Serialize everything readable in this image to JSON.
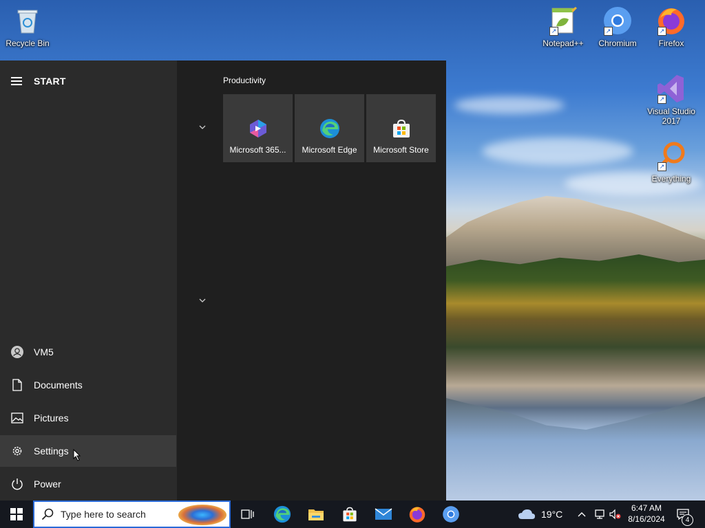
{
  "desktop": {
    "icons": [
      {
        "label": "Recycle Bin"
      },
      {
        "label": "Notepad++"
      },
      {
        "label": "Chromium"
      },
      {
        "label": "Firefox"
      },
      {
        "label": "Visual Studio 2017"
      },
      {
        "label": "Everything"
      }
    ]
  },
  "start_menu": {
    "title": "START",
    "sidebar": [
      {
        "label": "VM5",
        "icon": "user-icon"
      },
      {
        "label": "Documents",
        "icon": "document-icon"
      },
      {
        "label": "Pictures",
        "icon": "pictures-icon"
      },
      {
        "label": "Settings",
        "icon": "gear-icon"
      },
      {
        "label": "Power",
        "icon": "power-icon"
      }
    ],
    "group": {
      "title": "Productivity",
      "tiles": [
        {
          "label": "Microsoft 365..."
        },
        {
          "label": "Microsoft Edge"
        },
        {
          "label": "Microsoft Store"
        }
      ]
    }
  },
  "taskbar": {
    "search_placeholder": "Type here to search",
    "weather": {
      "temp": "19°C"
    },
    "clock": {
      "time": "6:47 AM",
      "date": "8/16/2024"
    },
    "notification_count": "4"
  },
  "colors": {
    "start_bg": "#1f1f1f",
    "sidebar_bg": "#2b2b2b",
    "tile_bg": "#3a3a3a",
    "taskbar_bg": "#15181f",
    "accent": "#2a6ad8"
  }
}
